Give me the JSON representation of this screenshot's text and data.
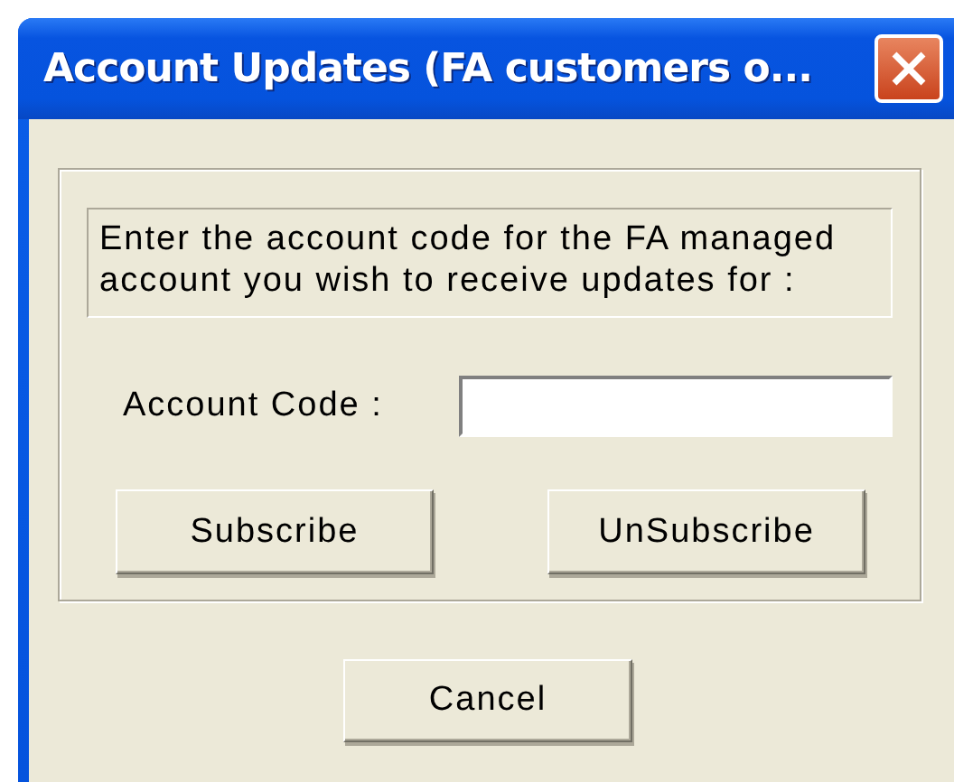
{
  "window": {
    "title": "Account Updates (FA customers o..."
  },
  "message": "Enter the account code for the FA managed account you wish to receive updates for :",
  "account_code": {
    "label": "Account Code :"
  },
  "buttons": [
    {
      "label": "Subscribe"
    },
    {
      "label": "UnSubscribe"
    }
  ],
  "cancel_button": {
    "label": "Cancel"
  }
}
